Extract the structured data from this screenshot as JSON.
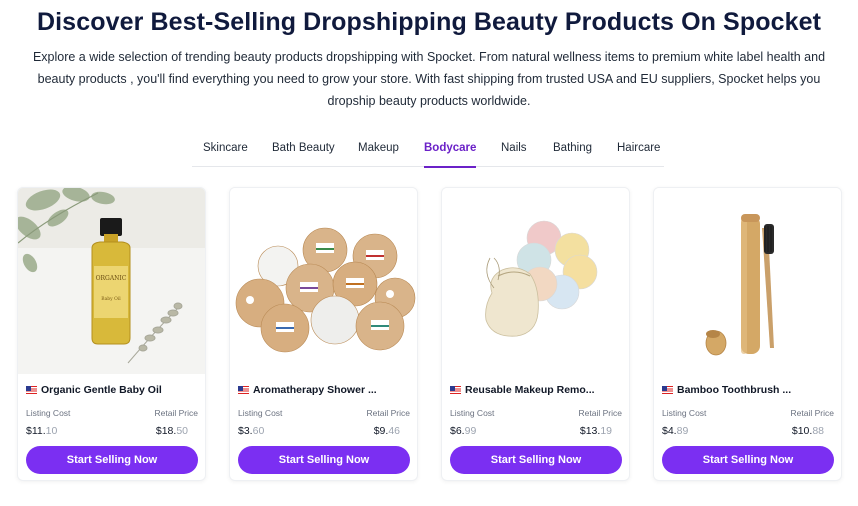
{
  "header": {
    "title": "Discover Best-Selling Dropshipping Beauty Products On Spocket",
    "description": "Explore a wide selection of trending beauty products dropshipping with Spocket. From natural wellness items to premium white label health and beauty products , you'll find everything you need to grow your store. With fast shipping from trusted USA and EU suppliers, Spocket helps you dropship beauty products worldwide."
  },
  "tabs": [
    {
      "label": "Skincare",
      "active": false
    },
    {
      "label": "Bath Beauty",
      "active": false
    },
    {
      "label": "Makeup",
      "active": false
    },
    {
      "label": "Bodycare",
      "active": true
    },
    {
      "label": "Nails",
      "active": false
    },
    {
      "label": "Bathing",
      "active": false
    },
    {
      "label": "Haircare",
      "active": false
    }
  ],
  "accent_color": "#7b2ff2",
  "products": [
    {
      "name": "Organic Gentle Baby Oil",
      "flag": "us-flag-icon",
      "listing_label": "Listing Cost",
      "retail_label": "Retail Price",
      "listing_main": "$11.",
      "listing_cents": "10",
      "retail_main": "$18.",
      "retail_cents": "50",
      "button": "Start Selling Now",
      "image_label": "ORGANIC",
      "image_label_2": "Baby Oil"
    },
    {
      "name": "Aromatherapy Shower ...",
      "flag": "us-flag-icon",
      "listing_label": "Listing Cost",
      "retail_label": "Retail Price",
      "listing_main": "$3.",
      "listing_cents": "60",
      "retail_main": "$9.",
      "retail_cents": "46",
      "button": "Start Selling Now"
    },
    {
      "name": "Reusable Makeup Remo...",
      "flag": "us-flag-icon",
      "listing_label": "Listing Cost",
      "retail_label": "Retail Price",
      "listing_main": "$6.",
      "listing_cents": "99",
      "retail_main": "$13.",
      "retail_cents": "19",
      "button": "Start Selling Now"
    },
    {
      "name": "Bamboo Toothbrush ...",
      "flag": "us-flag-icon",
      "listing_label": "Listing Cost",
      "retail_label": "Retail Price",
      "listing_main": "$4.",
      "listing_cents": "89",
      "retail_main": "$10.",
      "retail_cents": "88",
      "button": "Start Selling Now"
    }
  ]
}
